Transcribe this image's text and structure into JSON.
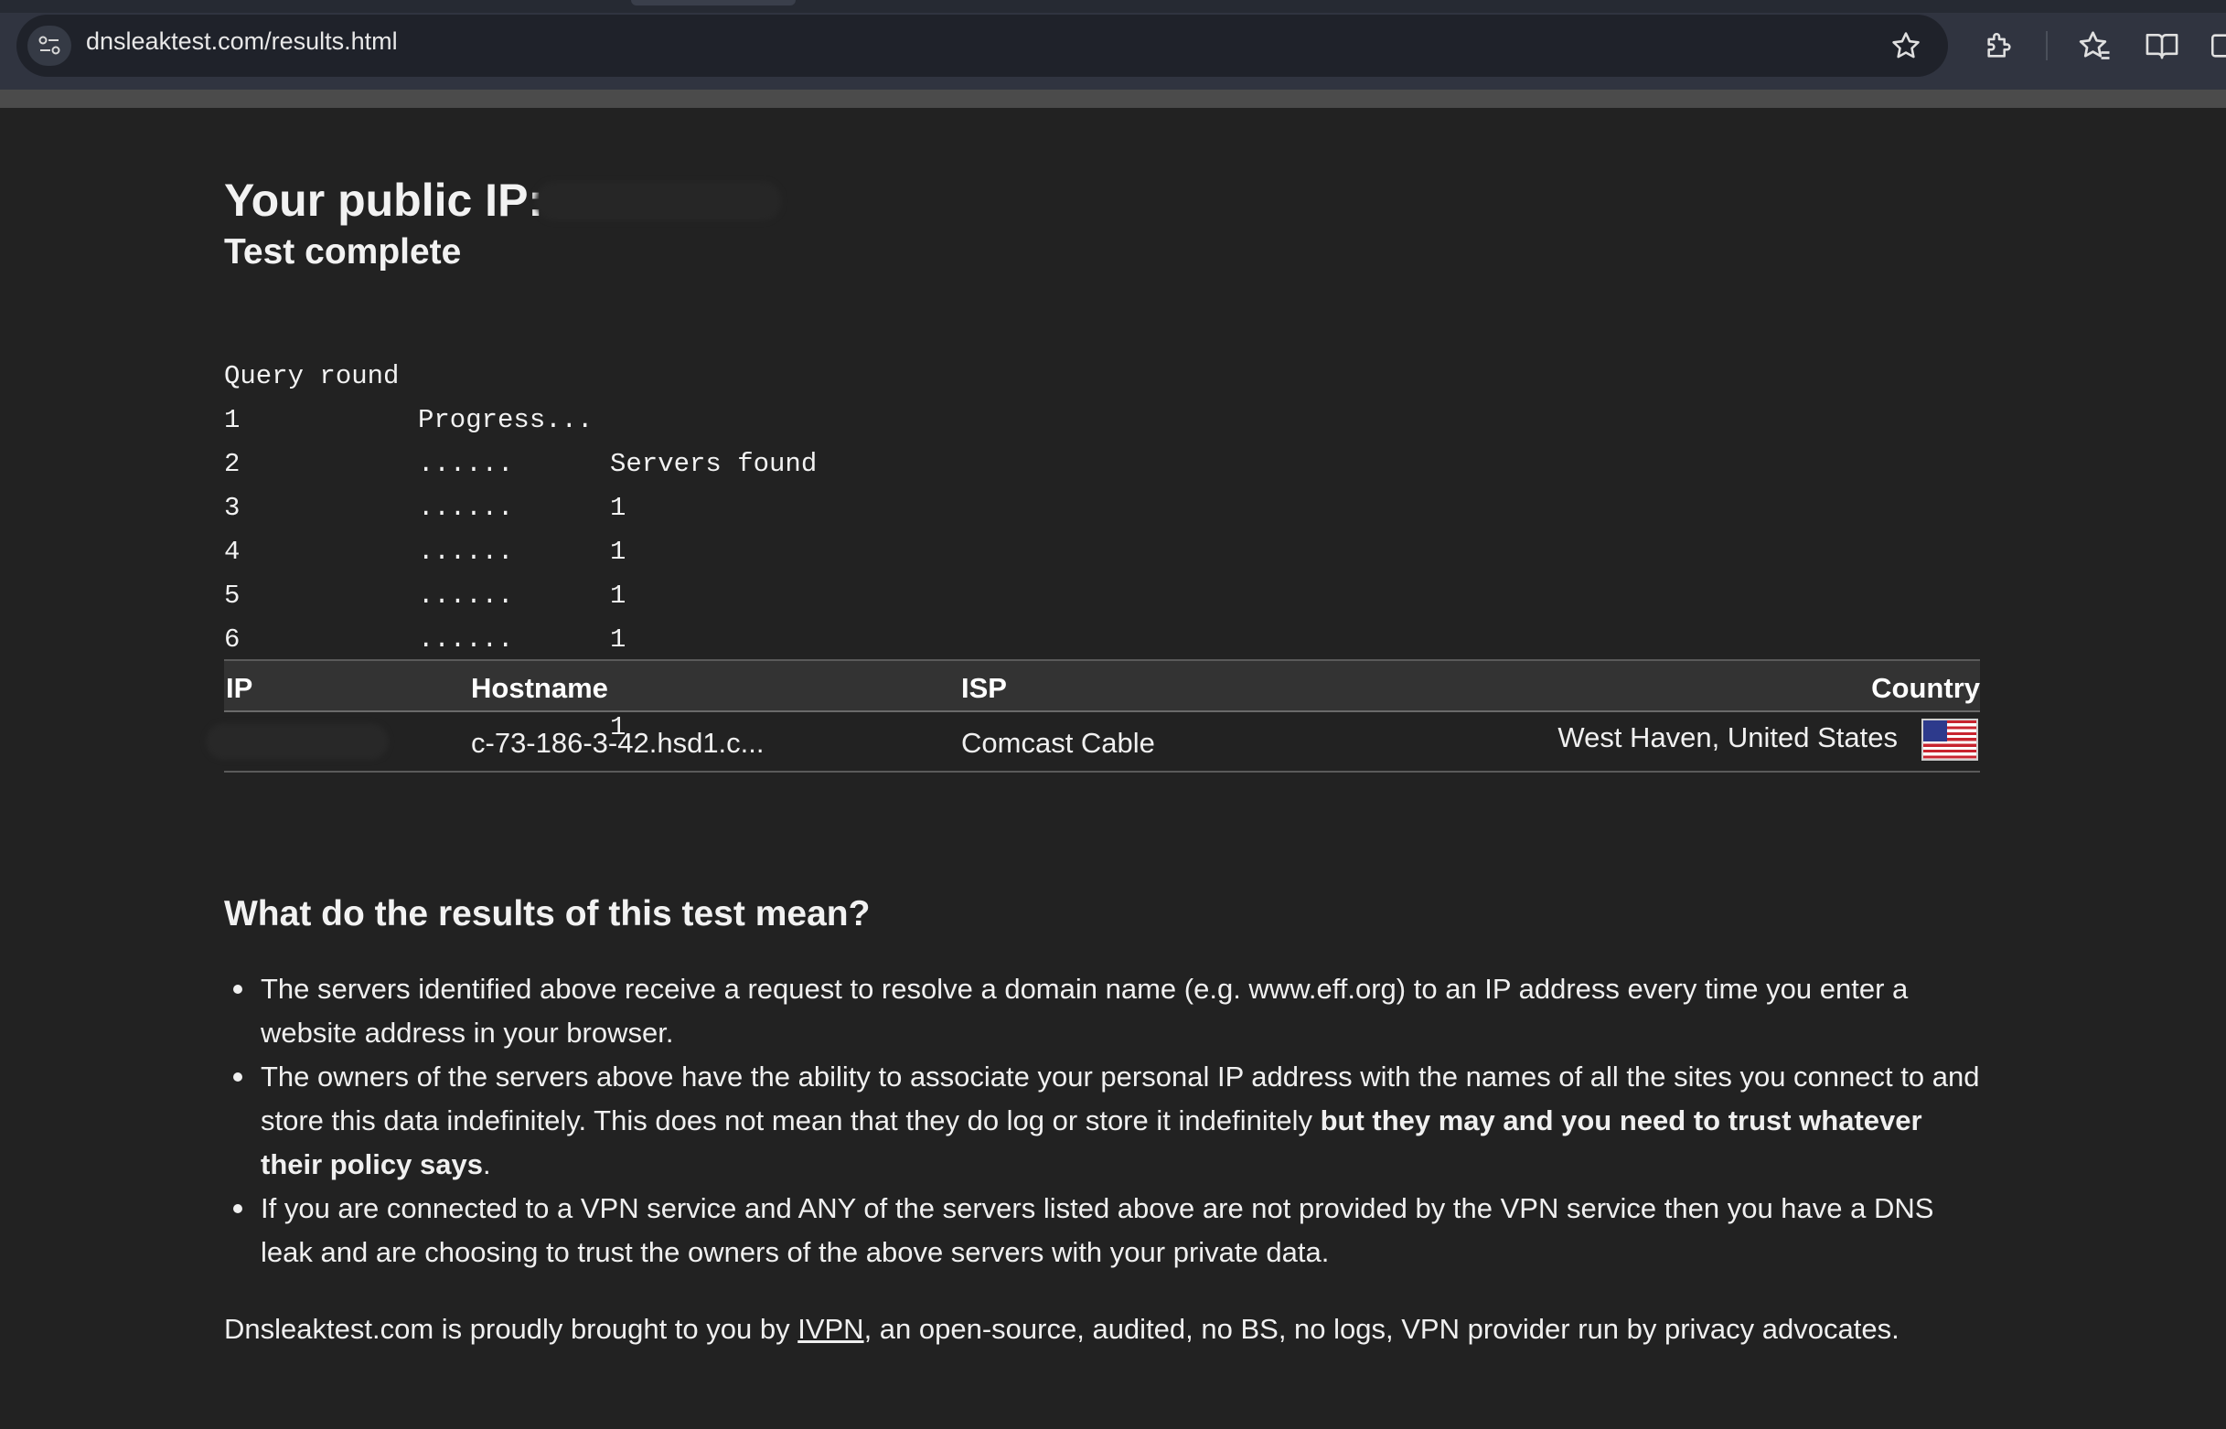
{
  "browser": {
    "url": "dnsleaktest.com/results.html",
    "icons": [
      "site-info-icon",
      "bookmark-star-icon",
      "extensions-icon",
      "favorites-icon",
      "reading-mode-icon",
      "split-screen-icon"
    ]
  },
  "header": {
    "title": "Your public IP:",
    "status": "Test complete"
  },
  "progress": {
    "headers": [
      "Query round",
      "Progress...",
      "Servers found"
    ],
    "rows": [
      {
        "round": "1",
        "progress": "......",
        "servers": "1"
      },
      {
        "round": "2",
        "progress": "......",
        "servers": "1"
      },
      {
        "round": "3",
        "progress": "......",
        "servers": "1"
      },
      {
        "round": "4",
        "progress": "......",
        "servers": "1"
      },
      {
        "round": "5",
        "progress": "......",
        "servers": "1"
      },
      {
        "round": "6",
        "progress": "......",
        "servers": "1"
      }
    ]
  },
  "results": {
    "headers": {
      "ip": "IP",
      "hostname": "Hostname",
      "isp": "ISP",
      "country": "Country"
    },
    "rows": [
      {
        "ip": "",
        "hostname": "c-73-186-3-42.hsd1.c...",
        "isp": "Comcast Cable",
        "country": "West Haven, United States",
        "flag": "us-flag-icon"
      }
    ]
  },
  "faq": {
    "title": "What do the results of this test mean?",
    "points": [
      {
        "text": "The servers identified above receive a request to resolve a domain name (e.g. www.eff.org) to an IP address every time you enter a website address in your browser."
      },
      {
        "text": "The owners of the servers above have the ability to associate your personal IP address with the names of all the sites you connect to and store this data indefinitely. This does not mean that they do log or store it indefinitely ",
        "bold": "but they may and you need to trust whatever their policy says",
        "tail": "."
      },
      {
        "text": "If you are connected to a VPN service and ANY of the servers listed above are not provided by the VPN service then you have a DNS leak and are choosing to trust the owners of the above servers with your private data."
      }
    ]
  },
  "footer": {
    "before": "Dnsleaktest.com is proudly brought to you by ",
    "link": "IVPN",
    "after": ", an open-source, audited, no BS, no logs, VPN provider run by privacy advocates."
  }
}
